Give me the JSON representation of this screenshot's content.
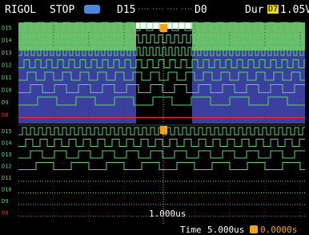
{
  "header": {
    "brand": "RIGOL",
    "run_status": "STOP",
    "trigger_source_left": "D15",
    "trigger_dots": "···· ···· ···· ····",
    "trigger_source_right": "D0",
    "mode": "Dur",
    "mode_badge": "D7",
    "threshold": "1.05V"
  },
  "footer": {
    "timebase_label": "Time",
    "timebase_value": "5.000us",
    "delay_icon": "delay-arrow-icon",
    "delay_value": "0.0000s"
  },
  "cursor_readout": "1.000us",
  "upper_channels": [
    "D15",
    "D14",
    "D13",
    "D12",
    "D11",
    "D10",
    "D9",
    "D8"
  ],
  "lower_channels": [
    "D15",
    "D14",
    "D13",
    "D12",
    "D11",
    "D10",
    "D9",
    "D8"
  ],
  "colors": {
    "trace_green": "#5dd36e",
    "trace_red": "#ff2a2a",
    "upper_fill_green": "#6aba6a",
    "upper_fill_blue": "#3f46a8",
    "trigger_marker": "#f7a21a",
    "header_white": "#ffffff",
    "accent_blue": "#4a88d8"
  }
}
